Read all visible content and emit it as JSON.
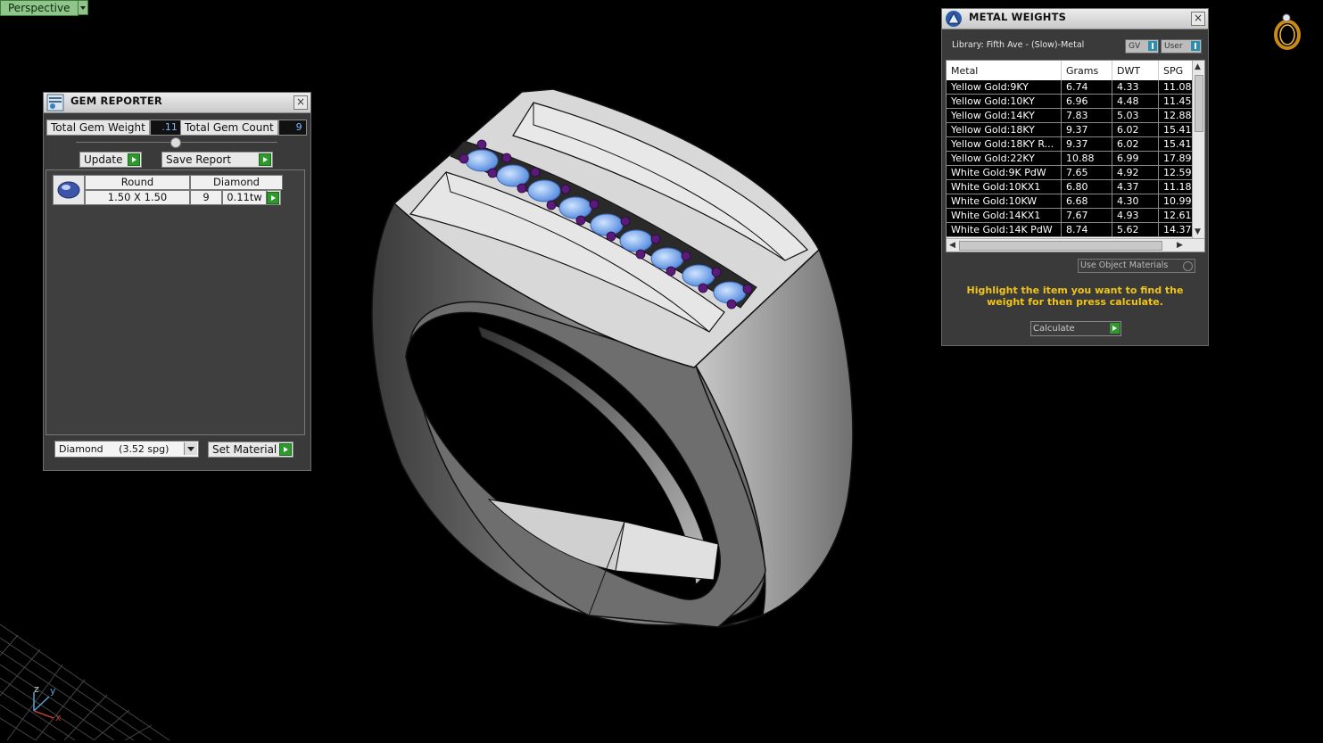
{
  "viewport": {
    "label": "Perspective",
    "axis": {
      "z": "z",
      "y": "y",
      "x": "x"
    }
  },
  "gem_reporter": {
    "title": "GEM REPORTER",
    "total_weight_label": "Total Gem Weight",
    "total_weight_value": ".11",
    "total_count_label": "Total Gem Count",
    "total_count_value": "9",
    "update_label": "Update",
    "save_report_label": "Save Report",
    "gem": {
      "shape": "Round",
      "material": "Diamond",
      "size": "1.50 X 1.50",
      "count": "9",
      "weight": "0.11tw"
    },
    "material_select": "Diamond     (3.52 spg)",
    "set_material_label": "Set Material"
  },
  "metal_weights": {
    "title": "METAL WEIGHTS",
    "library": "Library: Fifth Ave - (Slow)-Metal",
    "toggle_gv": "GV",
    "toggle_user": "User",
    "columns": [
      "Metal",
      "Grams",
      "DWT",
      "SPG"
    ],
    "rows": [
      [
        "Yellow Gold:9KY",
        "6.74",
        "4.33",
        "11.08"
      ],
      [
        "Yellow Gold:10KY",
        "6.96",
        "4.48",
        "11.45"
      ],
      [
        "Yellow Gold:14KY",
        "7.83",
        "5.03",
        "12.88"
      ],
      [
        "Yellow Gold:18KY",
        "9.37",
        "6.02",
        "15.41"
      ],
      [
        "Yellow Gold:18KY R...",
        "9.37",
        "6.02",
        "15.41"
      ],
      [
        "Yellow Gold:22KY",
        "10.88",
        "6.99",
        "17.89"
      ],
      [
        "White Gold:9K PdW",
        "7.65",
        "4.92",
        "12.59"
      ],
      [
        "White Gold:10KX1",
        "6.80",
        "4.37",
        "11.18"
      ],
      [
        "White Gold:10KW",
        "6.68",
        "4.30",
        "10.99"
      ],
      [
        "White Gold:14KX1",
        "7.67",
        "4.93",
        "12.61"
      ],
      [
        "White Gold:14K PdW",
        "8.74",
        "5.62",
        "14.37"
      ]
    ],
    "use_object_materials": "Use Object Materials",
    "hint": "Highlight the item you want to find the weight for then press calculate.",
    "calculate_label": "Calculate"
  }
}
